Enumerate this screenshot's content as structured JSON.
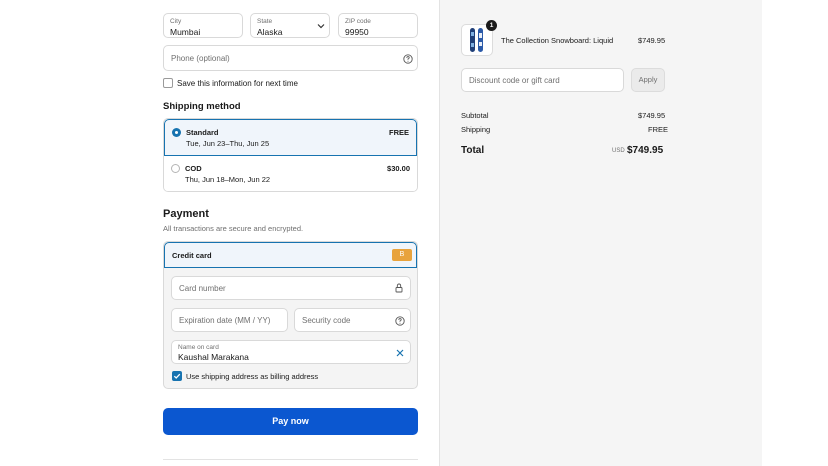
{
  "address": {
    "city_label": "City",
    "city_value": "Mumbai",
    "state_label": "State",
    "state_value": "Alaska",
    "zip_label": "ZIP code",
    "zip_value": "99950",
    "phone_placeholder": "Phone (optional)",
    "save_info_label": "Save this information for next time"
  },
  "shipping": {
    "heading": "Shipping method",
    "options": [
      {
        "name": "Standard",
        "dates": "Tue, Jun 23–Thu, Jun 25",
        "price": "FREE",
        "selected": true
      },
      {
        "name": "COD",
        "dates": "Thu, Jun 18–Mon, Jun 22",
        "price": "$30.00",
        "selected": false
      }
    ]
  },
  "payment": {
    "heading": "Payment",
    "subheading": "All transactions are secure and encrypted.",
    "method_label": "Credit card",
    "method_badge": "B",
    "card_number_placeholder": "Card number",
    "expiry_placeholder": "Expiration date (MM / YY)",
    "security_placeholder": "Security code",
    "name_label": "Name on card",
    "name_value": "Kaushal Marakana",
    "billing_label": "Use shipping address as billing address",
    "billing_checked": true
  },
  "pay_button_label": "Pay now",
  "summary": {
    "product_name": "The Collection Snowboard: Liquid",
    "product_price": "$749.95",
    "product_qty": "1",
    "discount_placeholder": "Discount code or gift card",
    "apply_label": "Apply",
    "subtotal_label": "Subtotal",
    "subtotal_value": "$749.95",
    "shipping_label": "Shipping",
    "shipping_value": "FREE",
    "total_label": "Total",
    "currency": "USD",
    "total_value": "$749.95"
  },
  "colors": {
    "accent": "#1773b0",
    "button": "#0b57d0",
    "selected_bg": "#f0f5fb",
    "badge": "#e8a33d"
  }
}
